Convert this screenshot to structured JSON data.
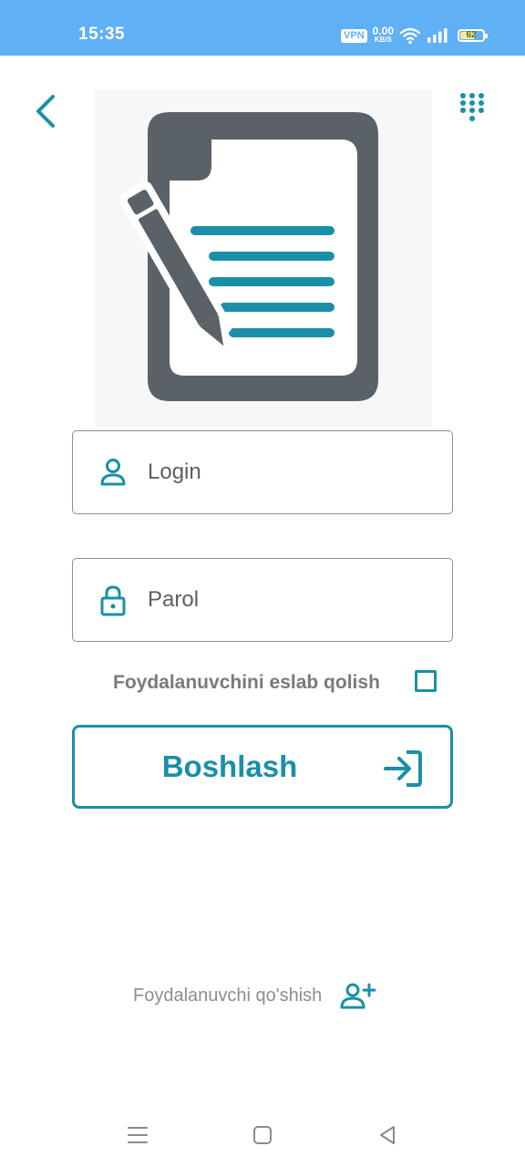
{
  "status_bar": {
    "time": "15:35",
    "vpn": "VPN",
    "net_speed_value": "0.00",
    "net_speed_unit": "KB/S",
    "battery_level": "62",
    "icons": [
      "wifi-icon",
      "signal-icon",
      "battery-icon"
    ]
  },
  "header": {
    "back_icon": "chevron-left-icon",
    "menu_icon": "dialpad-icon"
  },
  "illustration": {
    "icon": "document-edit-icon"
  },
  "form": {
    "login": {
      "placeholder": "Login",
      "value": "",
      "icon": "user-icon"
    },
    "password": {
      "placeholder": "Parol",
      "value": "",
      "icon": "lock-icon"
    },
    "remember_label": "Foydalanuvchini eslab qolish",
    "remember_checked": false,
    "submit_label": "Boshlash",
    "submit_icon": "login-arrow-icon"
  },
  "footer": {
    "add_user_label": "Foydalanuvchi qo'shish",
    "add_user_icon": "user-plus-icon"
  },
  "nav": [
    "menu-nav-icon",
    "home-nav-icon",
    "back-nav-icon"
  ],
  "colors": {
    "accent": "#1a8fa8",
    "status_bar": "#5fb0f5",
    "illustration_dark": "#5a6167",
    "illustration_lines": "#1a8fa8"
  }
}
